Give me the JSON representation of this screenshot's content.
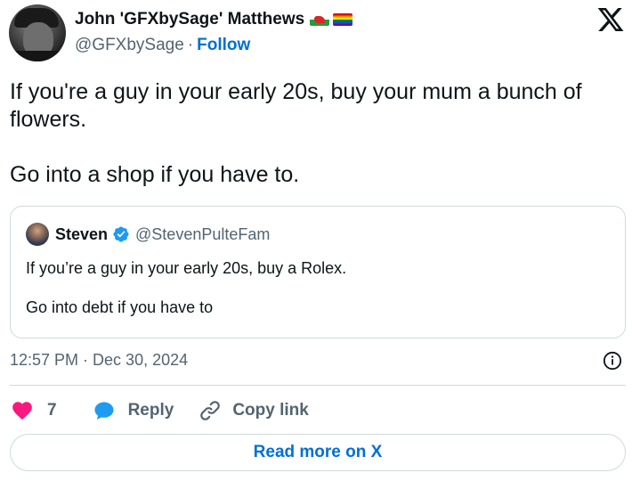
{
  "author": {
    "display_name": "John 'GFXbySage' Matthews",
    "handle": "@GFXbySage",
    "separator": "·",
    "follow_label": "Follow"
  },
  "tweet": {
    "paragraphs": [
      "If you're a guy in your early 20s, buy your mum a bunch of flowers.",
      "Go into a shop if you have to."
    ]
  },
  "quoted_tweet": {
    "display_name": "Steven",
    "handle": "@StevenPulteFam",
    "paragraphs": [
      "If you’re a guy in your early 20s, buy a Rolex.",
      "Go into debt if you have to"
    ]
  },
  "meta": {
    "timestamp": "12:57 PM · Dec 30, 2024"
  },
  "actions": {
    "like_count": "7",
    "reply_label": "Reply",
    "copy_link_label": "Copy link"
  },
  "footer": {
    "read_more_label": "Read more on X"
  },
  "colors": {
    "link_blue": "#006fd6",
    "secondary_text": "#536471",
    "border": "#cfd9de",
    "like_pink": "#f91880",
    "reply_blue": "#1d9bf0",
    "verified_blue": "#1d9bf0"
  },
  "icons": [
    "x-logo-icon",
    "wales-flag-icon",
    "rainbow-flag-icon",
    "verified-badge-icon",
    "info-icon",
    "heart-icon",
    "speech-bubble-icon",
    "link-icon"
  ]
}
